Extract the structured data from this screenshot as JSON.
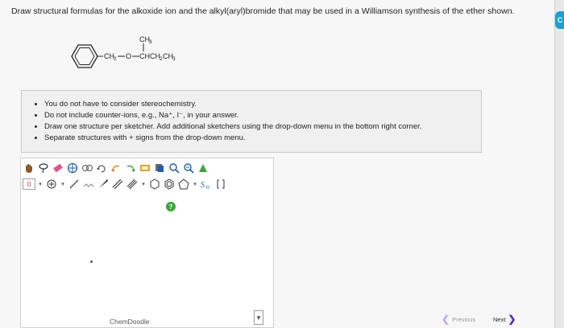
{
  "question": {
    "text": "Draw structural formulas for the alkoxide ion and the alkyl(aryl)bromide that may be used in a Williamson synthesis of the ether shown."
  },
  "molecule": {
    "methyl_label": "CH",
    "methyl_sub": "3",
    "chain_ch2": "CH",
    "chain_ch2_sub": "2",
    "oxygen": "O",
    "chain_rest_1": "CHCH",
    "chain_rest_sub1": "2",
    "chain_rest_2": "CH",
    "chain_rest_sub2": "3"
  },
  "notes": {
    "items": [
      "You do not have to consider stereochemistry.",
      "Do not include counter-ions, e.g., Na⁺, I⁻, in your answer.",
      "Draw one structure per sketcher. Add additional sketchers using the drop-down menu in the bottom right corner.",
      "Separate structures with + signs from the drop-down menu."
    ]
  },
  "sketcher": {
    "charge_value": "0",
    "brand": "ChemDoodle",
    "help_badge": "?",
    "select_arrow": "⌵"
  },
  "nav": {
    "previous": "Previous",
    "next": "Next"
  },
  "rail": {
    "button_label": "C"
  },
  "colors": {
    "accent": "#5b2fb8",
    "help_green": "#3aa63a",
    "rail_blue": "#1ba1d4"
  }
}
